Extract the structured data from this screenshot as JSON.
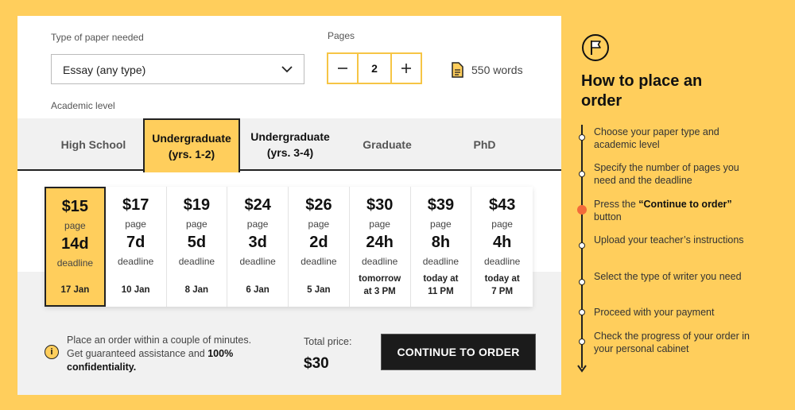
{
  "form": {
    "paper_type_label": "Type of paper needed",
    "paper_type_value": "Essay (any type)",
    "pages_label": "Pages",
    "pages_value": "2",
    "words": "550 words",
    "academic_level_label": "Academic level"
  },
  "levels": [
    {
      "line1": "High School",
      "line2": ""
    },
    {
      "line1": "Undergraduate",
      "line2": "(yrs. 1-2)"
    },
    {
      "line1": "Undergraduate",
      "line2": "(yrs. 3-4)"
    },
    {
      "line1": "Graduate",
      "line2": ""
    },
    {
      "line1": "PhD",
      "line2": ""
    }
  ],
  "deadlines": [
    {
      "price": "$15",
      "unit": "page",
      "time": "14d",
      "label": "deadline",
      "date1": "17 Jan",
      "date2": ""
    },
    {
      "price": "$17",
      "unit": "page",
      "time": "7d",
      "label": "deadline",
      "date1": "10 Jan",
      "date2": ""
    },
    {
      "price": "$19",
      "unit": "page",
      "time": "5d",
      "label": "deadline",
      "date1": "8 Jan",
      "date2": ""
    },
    {
      "price": "$24",
      "unit": "page",
      "time": "3d",
      "label": "deadline",
      "date1": "6 Jan",
      "date2": ""
    },
    {
      "price": "$26",
      "unit": "page",
      "time": "2d",
      "label": "deadline",
      "date1": "5 Jan",
      "date2": ""
    },
    {
      "price": "$30",
      "unit": "page",
      "time": "24h",
      "label": "deadline",
      "date1": "tomorrow",
      "date2": "at 3 PM"
    },
    {
      "price": "$39",
      "unit": "page",
      "time": "8h",
      "label": "deadline",
      "date1": "today at",
      "date2": "11 PM"
    },
    {
      "price": "$43",
      "unit": "page",
      "time": "4h",
      "label": "deadline",
      "date1": "today at",
      "date2": "7 PM"
    }
  ],
  "footer": {
    "info_text_1": "Place an order within a couple of minutes. Get guaranteed assistance and ",
    "info_text_bold": "100% confidentiality.",
    "total_label": "Total price:",
    "total_value": "$30",
    "cta_label": "CONTINUE TO ORDER"
  },
  "howto": {
    "title": "How to place an order",
    "steps": [
      {
        "pre": "Choose your paper type and academic level",
        "bold": "",
        "post": ""
      },
      {
        "pre": "Specify the number of pages you need and the deadline",
        "bold": "",
        "post": ""
      },
      {
        "pre": "Press the ",
        "bold": "“Continue to order”",
        "post": " button"
      },
      {
        "pre": "Upload your teacher’s instructions",
        "bold": "",
        "post": ""
      },
      {
        "pre": "Select the type of writer you need",
        "bold": "",
        "post": ""
      },
      {
        "pre": "Proceed with your payment",
        "bold": "",
        "post": ""
      },
      {
        "pre": "Check the progress of your order in your personal cabinet",
        "bold": "",
        "post": ""
      }
    ]
  },
  "colors": {
    "accent": "#FFCE5C",
    "dark": "#1B1B1B",
    "active_dot": "#F36B3A"
  },
  "icons": [
    "chevron-down-icon",
    "minus-icon",
    "plus-icon",
    "document-icon",
    "info-icon",
    "flag-icon",
    "arrow-down-icon"
  ]
}
